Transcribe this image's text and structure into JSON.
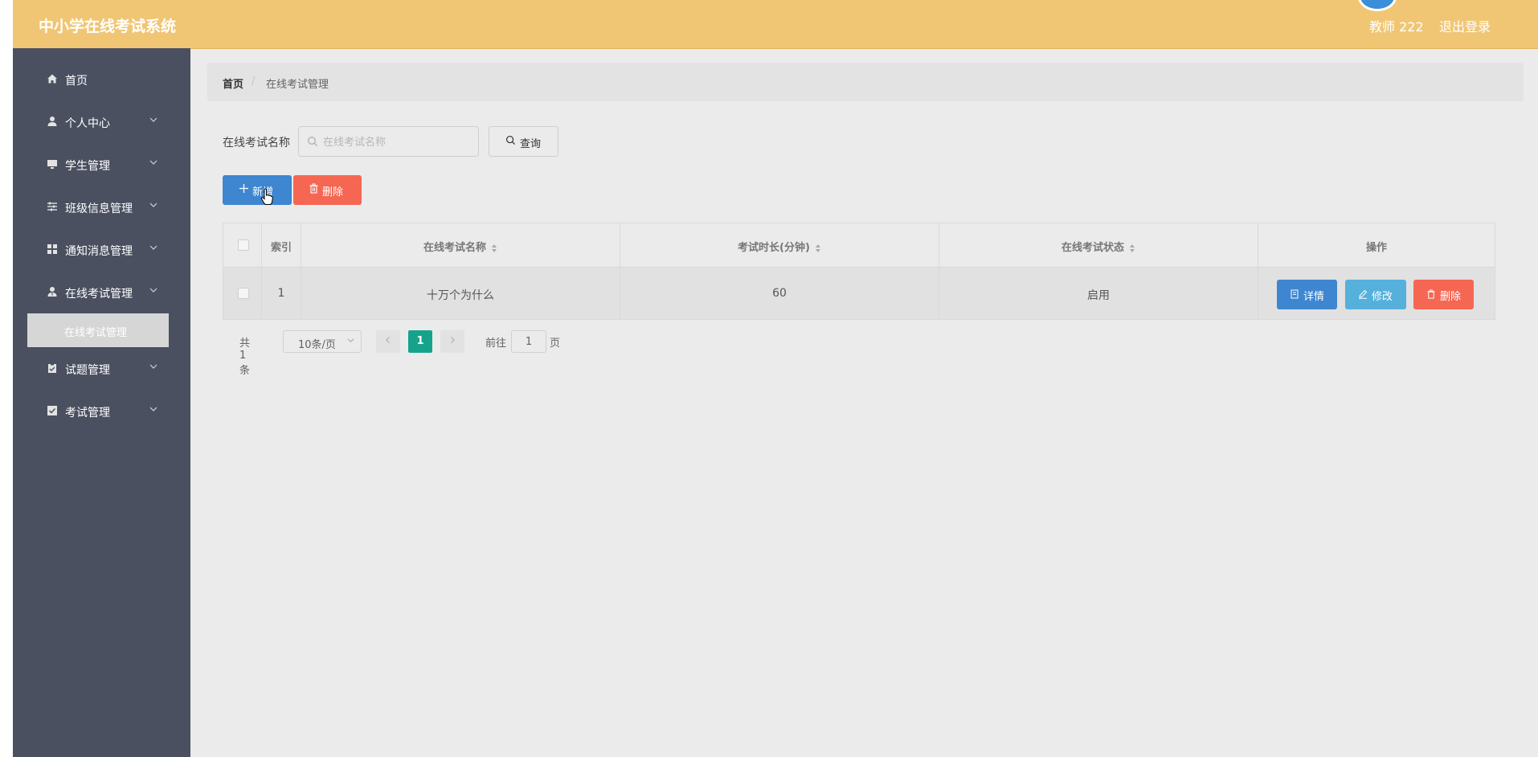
{
  "app": {
    "title": "中小学在线考试系统",
    "user": "教师 222",
    "logout": "退出登录"
  },
  "sidebar": {
    "items": [
      {
        "label": "首页",
        "icon": "home-icon"
      },
      {
        "label": "个人中心",
        "icon": "user-icon"
      },
      {
        "label": "学生管理",
        "icon": "monitor-icon"
      },
      {
        "label": "班级信息管理",
        "icon": "sliders-icon"
      },
      {
        "label": "通知消息管理",
        "icon": "grid-icon"
      },
      {
        "label": "在线考试管理",
        "icon": "user-tie-icon"
      },
      {
        "label": "试题管理",
        "icon": "clipboard-icon"
      },
      {
        "label": "考试管理",
        "icon": "checkbox-icon"
      }
    ],
    "sub_active": "在线考试管理"
  },
  "breadcrumb": {
    "home": "首页",
    "sep": "/",
    "current": "在线考试管理"
  },
  "search": {
    "label": "在线考试名称",
    "placeholder": "在线考试名称",
    "button": "查询"
  },
  "toolbar": {
    "add": "新增",
    "delete": "删除"
  },
  "table": {
    "columns": [
      "索引",
      "在线考试名称",
      "考试时长(分钟)",
      "在线考试状态",
      "操作"
    ],
    "rows": [
      {
        "index": "1",
        "name": "十万个为什么",
        "duration": "60",
        "status": "启用"
      }
    ],
    "actions": {
      "detail": "详情",
      "edit": "修改",
      "delete": "删除"
    }
  },
  "pagination": {
    "total": "共 1 条",
    "page_size": "10条/页",
    "current": "1",
    "goto_label": "前往",
    "goto_value": "1",
    "page_unit": "页"
  },
  "colors": {
    "header": "#f0c674",
    "sidebar": "#4a5060",
    "primary": "#3e86d0",
    "danger": "#f56753",
    "info": "#55b0dc",
    "page_active": "#16a38c"
  }
}
